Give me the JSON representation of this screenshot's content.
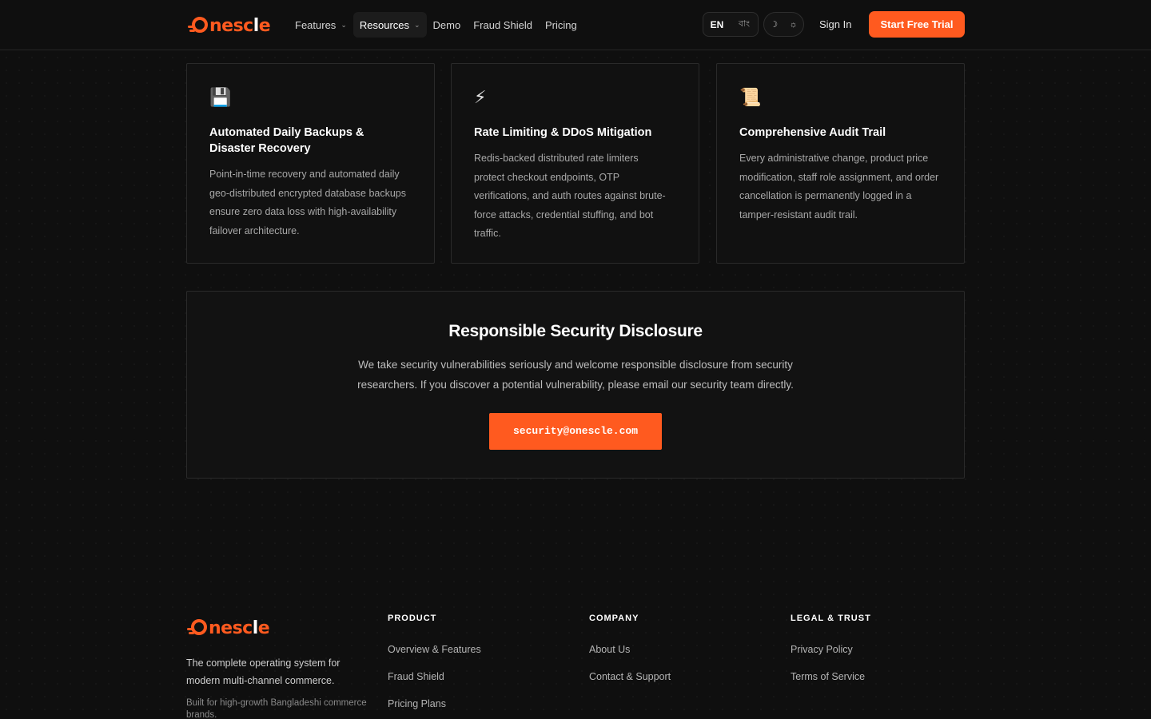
{
  "brand": {
    "logo_text_accent": "nesc",
    "logo_text_mid": "l",
    "logo_text_end": "e"
  },
  "nav": {
    "items": [
      {
        "label": "Features",
        "dropdown": true
      },
      {
        "label": "Resources",
        "dropdown": true,
        "active": true
      },
      {
        "label": "Demo"
      },
      {
        "label": "Fraud Shield"
      },
      {
        "label": "Pricing"
      }
    ],
    "lang_en": "EN",
    "lang_bn": "বাং",
    "sign_in": "Sign In",
    "cta": "Start Free Trial"
  },
  "cards": [
    {
      "icon": "floppy-disk-icon",
      "glyph": "💾",
      "title": "Automated Daily Backups & Disaster Recovery",
      "body": "Point-in-time recovery and automated daily geo-distributed encrypted database backups ensure zero data loss with high-availability failover architecture."
    },
    {
      "icon": "lightning-icon",
      "glyph": "⚡",
      "title": "Rate Limiting & DDoS Mitigation",
      "body": "Redis-backed distributed rate limiters protect checkout endpoints, OTP verifications, and auth routes against brute-force attacks, credential stuffing, and bot traffic."
    },
    {
      "icon": "scroll-icon",
      "glyph": "📜",
      "title": "Comprehensive Audit Trail",
      "body": "Every administrative change, product price modification, staff role assignment, and order cancellation is permanently logged in a tamper-resistant audit trail."
    }
  ],
  "disclosure": {
    "title": "Responsible Security Disclosure",
    "body": "We take security vulnerabilities seriously and welcome responsible disclosure from security researchers. If you discover a potential vulnerability, please email our security team directly.",
    "email": "security@onescle.com"
  },
  "footer": {
    "tagline": "The complete operating system for modern multi-channel commerce.",
    "subtagline": "Built for high-growth Bangladeshi commerce brands.",
    "columns": [
      {
        "heading": "PRODUCT",
        "links": [
          "Overview & Features",
          "Fraud Shield",
          "Pricing Plans"
        ]
      },
      {
        "heading": "COMPANY",
        "links": [
          "About Us",
          "Contact & Support"
        ]
      },
      {
        "heading": "LEGAL & TRUST",
        "links": [
          "Privacy Policy",
          "Terms of Service"
        ]
      }
    ]
  },
  "colors": {
    "accent": "#ff5a1f",
    "background": "#0f0f0f",
    "card": "#111111",
    "border": "#2a2a2a"
  }
}
